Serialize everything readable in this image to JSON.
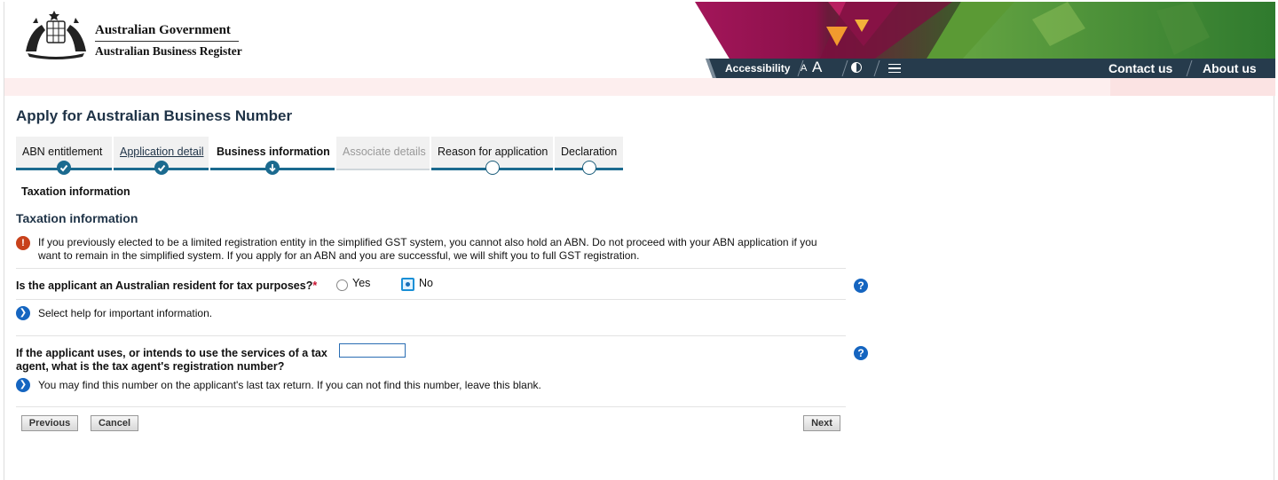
{
  "header": {
    "gov_line1": "Australian Government",
    "gov_line2": "Australian Business Register",
    "nav": {
      "accessibility": "Accessibility",
      "font_small": "A",
      "font_large": "A",
      "contact_us": "Contact us",
      "about_us": "About us"
    }
  },
  "page_title": "Apply for Australian Business Number",
  "steps": [
    {
      "label": "ABN entitlement",
      "state": "completed"
    },
    {
      "label": "Application detail",
      "state": "completed-link"
    },
    {
      "label": "Business information",
      "state": "current"
    },
    {
      "label": "Associate details",
      "state": "disabled"
    },
    {
      "label": "Reason for application",
      "state": "pending"
    },
    {
      "label": "Declaration",
      "state": "pending"
    }
  ],
  "sub_step": "Taxation information",
  "section_title": "Taxation information",
  "warning_text": "If you previously elected to be a limited registration entity in the simplified GST system, you cannot also hold an ABN. Do not proceed with your ABN application if you want to remain in the simplified system. If you apply for an ABN and you are successful, we will shift you to full GST registration.",
  "q1": {
    "label": "Is the applicant an Australian resident for tax purposes?",
    "required_mark": "*",
    "options": [
      "Yes",
      "No"
    ],
    "selected": "No",
    "info": "Select help for important information."
  },
  "q2": {
    "label": "If the applicant uses, or intends to use the services of a tax agent, what is the tax agent's registration number?",
    "value": "",
    "info": "You may find this number on the applicant's last tax return. If you can not find this number, leave this blank."
  },
  "buttons": {
    "previous": "Previous",
    "cancel": "Cancel",
    "next": "Next"
  },
  "icons": {
    "help": "?",
    "warning": "!",
    "info": "chevron-right-icon"
  },
  "colors": {
    "nav_bar": "#263b4c",
    "step_active": "#1b6a8f",
    "help_blue": "#1565c0",
    "warning_red": "#c8411b"
  }
}
